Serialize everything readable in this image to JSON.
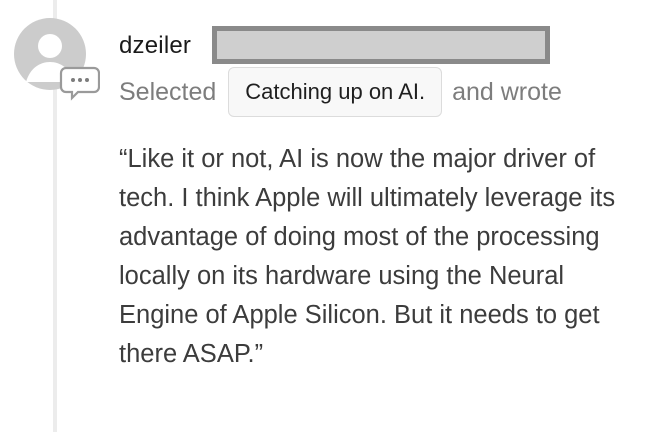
{
  "comment": {
    "author": "dzeiler",
    "action_prefix": "Selected",
    "selected_text": "Catching up on AI.",
    "action_suffix": "and wrote",
    "body": "“Like it or not, AI is now the major driver of tech. I think Apple will ultimately leverage its advantage of doing most of the processing locally on its hardware using the Neural Engine of Apple Silicon. But it needs to get there ASAP.”"
  },
  "icons": {
    "avatar": "default-avatar-icon",
    "badge": "comment-bubble-icon"
  },
  "colors": {
    "avatar_gray": "#cccccc",
    "thread_line": "#ececec",
    "muted_text": "#7d7d7d",
    "redaction_border": "#8a8a8a",
    "redaction_fill": "#cfcfcf"
  }
}
